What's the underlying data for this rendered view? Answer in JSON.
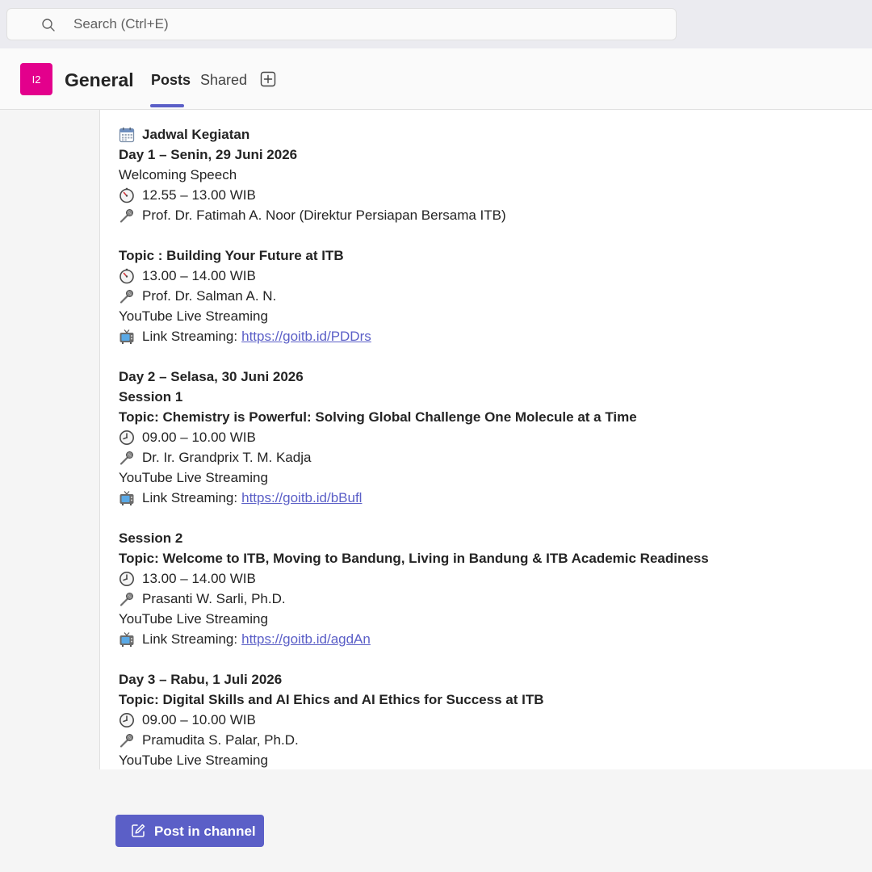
{
  "search": {
    "placeholder": "Search (Ctrl+E)"
  },
  "header": {
    "team_avatar": "I2",
    "channel_title": "General",
    "tabs": [
      {
        "label": "Posts",
        "active": true
      },
      {
        "label": "Shared",
        "active": false
      }
    ]
  },
  "post": {
    "heading": "Jadwal Kegiatan",
    "day1": {
      "title": "Day 1 – Senin, 29 Juni 2026",
      "welcome": {
        "title": "Welcoming Speech",
        "time": "12.55 – 13.00 WIB",
        "speaker": "Prof. Dr. Fatimah A. Noor (Direktur Persiapan Bersama ITB)"
      },
      "topic1": {
        "title": "Topic : Building Your Future at ITB",
        "time": "13.00 – 14.00 WIB",
        "speaker": "Prof. Dr. Salman A. N.",
        "platform": "YouTube Live Streaming",
        "link_label": "Link Streaming:",
        "link": "https://goitb.id/PDDrs"
      }
    },
    "day2": {
      "title": "Day 2 – Selasa, 30 Juni 2026",
      "session1": {
        "label": "Session 1",
        "title": "Topic: Chemistry is Powerful: Solving Global Challenge One Molecule at a Time",
        "time": "09.00 – 10.00 WIB",
        "speaker": "Dr. Ir. Grandprix T. M. Kadja",
        "platform": "YouTube Live Streaming",
        "link_label": "Link Streaming:",
        "link": "https://goitb.id/bBufl"
      },
      "session2": {
        "label": "Session 2",
        "title": "Topic: Welcome to ITB, Moving to Bandung, Living in Bandung & ITB Academic Readiness",
        "time": "13.00 – 14.00 WIB",
        "speaker": "Prasanti W. Sarli, Ph.D.",
        "platform": "YouTube Live Streaming",
        "link_label": "Link Streaming:",
        "link": "https://goitb.id/agdAn"
      }
    },
    "day3": {
      "title": "Day 3 – Rabu, 1 Juli 2026",
      "topic": {
        "title": "Topic: Digital Skills and AI Ehics and AI Ethics for Success at ITB",
        "time": "09.00 – 10.00 WIB",
        "speaker": "Pramudita S. Palar, Ph.D.",
        "platform": "YouTube Live Streaming"
      }
    }
  },
  "compose": {
    "button_label": "Post in channel"
  },
  "colors": {
    "accent": "#5b5fc7",
    "team_avatar": "#e3008c",
    "link": "#5b5fc7"
  }
}
